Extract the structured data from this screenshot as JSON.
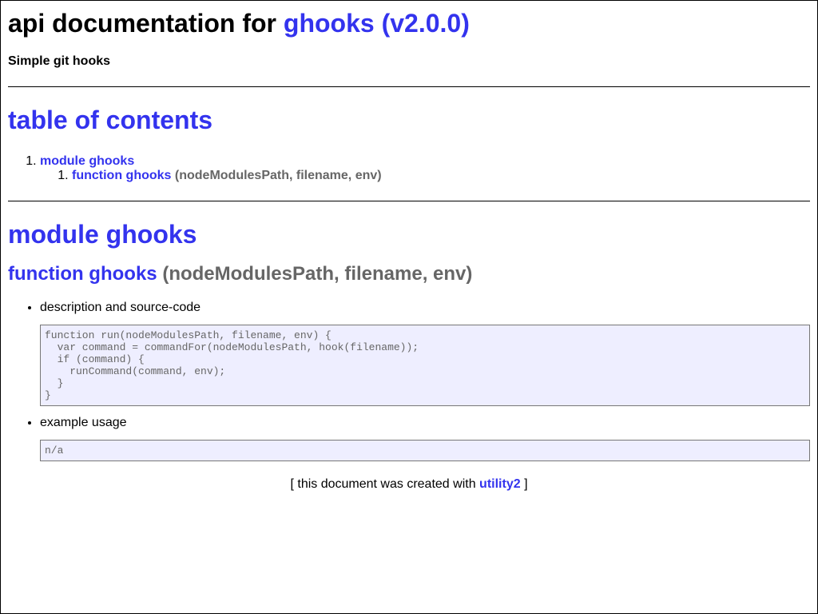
{
  "header": {
    "title_prefix": "api documentation for",
    "package_link": "ghooks (v2.0.0)",
    "description": "Simple git hooks"
  },
  "toc": {
    "heading": "table of contents",
    "module_link": "module ghooks",
    "function_link": "function ghooks",
    "function_signature": "(nodeModulesPath, filename, env)"
  },
  "module": {
    "heading": "module ghooks",
    "function_link": "function ghooks",
    "function_signature": "(nodeModulesPath, filename, env)",
    "description_label": "description and source-code",
    "source_code": "function run(nodeModulesPath, filename, env) {\n  var command = commandFor(nodeModulesPath, hook(filename));\n  if (command) {\n    runCommand(command, env);\n  }\n}",
    "example_label": "example usage",
    "example_code": "n/a"
  },
  "footer": {
    "prefix": "[ this document was created with",
    "link": "utility2",
    "suffix": "]"
  },
  "colors": {
    "link": "#3333ee",
    "signature": "#666666",
    "code_background": "#eeeeff"
  }
}
